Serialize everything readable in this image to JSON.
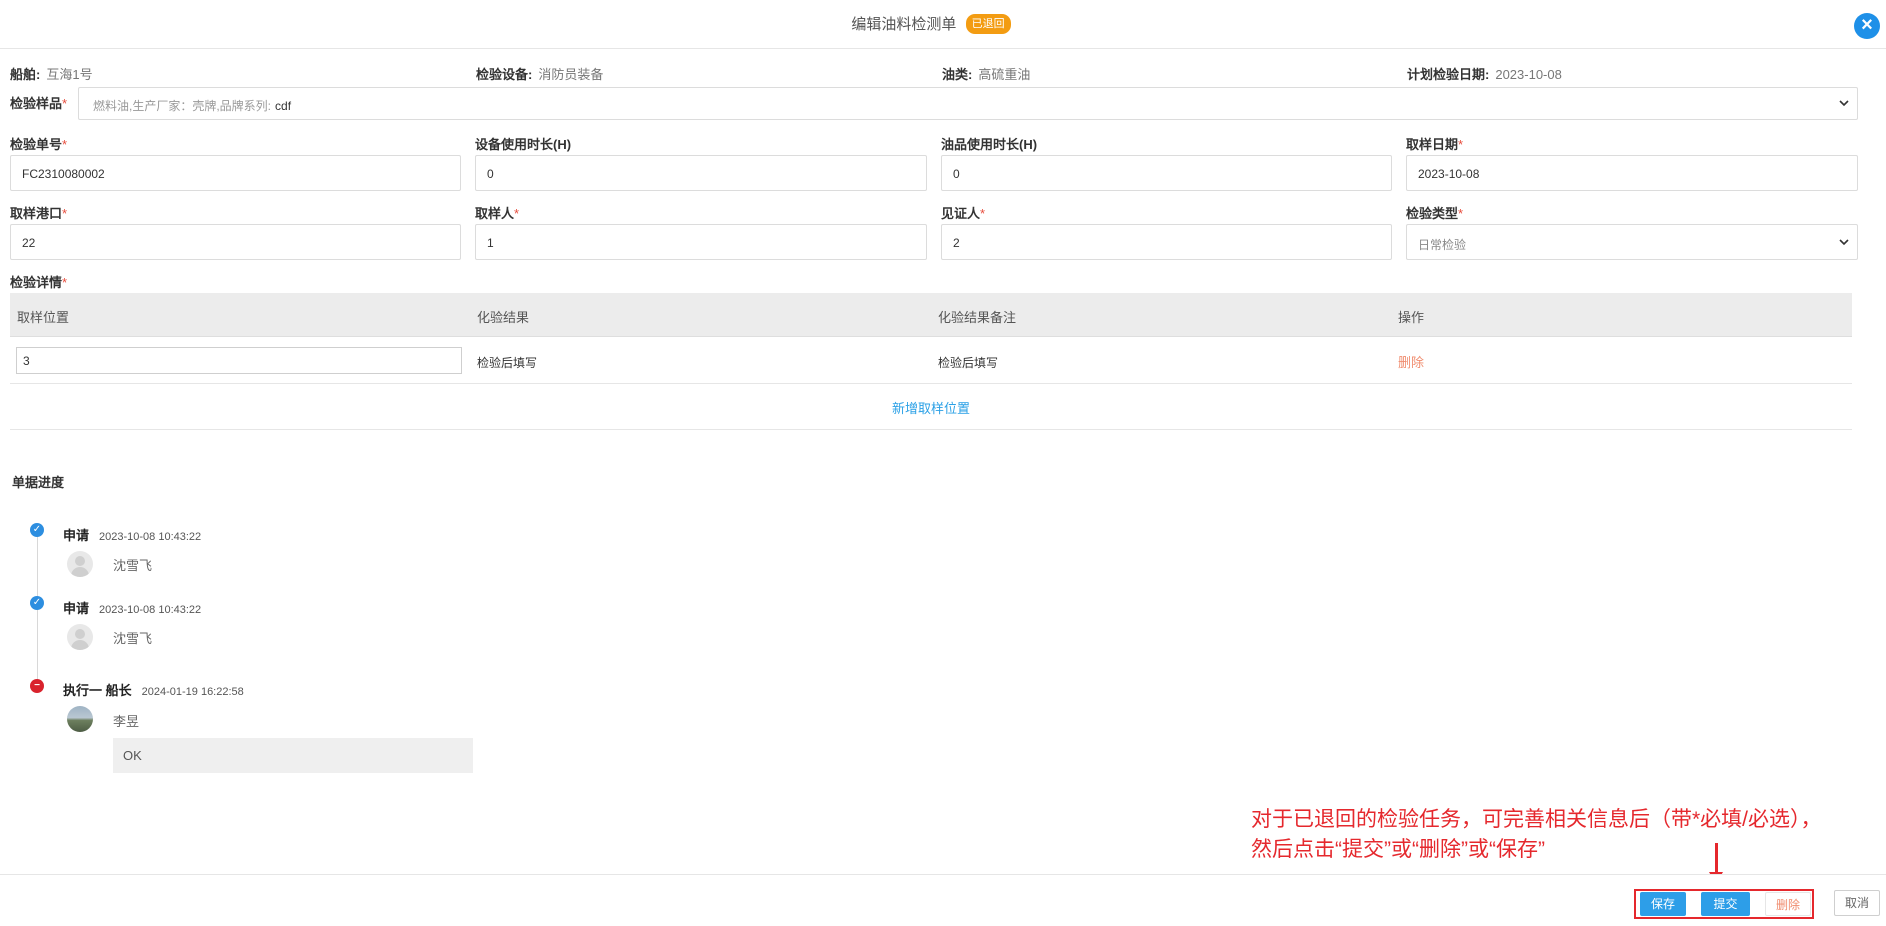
{
  "header": {
    "title": "编辑油料检测单",
    "status_badge": "已退回",
    "close_icon": "close-icon"
  },
  "info": [
    {
      "label": "船舶:",
      "value": "互海1号"
    },
    {
      "label": "检验设备:",
      "value": "消防员装备"
    },
    {
      "label": "油类:",
      "value": "高硫重油"
    },
    {
      "label": "计划检验日期:",
      "value": "2023-10-08"
    }
  ],
  "sample": {
    "label": "检验样品",
    "required": "*",
    "placeholder": "燃料油,生产厂家：壳牌,品牌系列:",
    "value": "cdf"
  },
  "fields": {
    "order_no": {
      "label": "检验单号",
      "required": "*",
      "value": "FC2310080002"
    },
    "equip_hours": {
      "label": "设备使用时长(H)",
      "value": "0"
    },
    "oil_hours": {
      "label": "油品使用时长(H)",
      "value": "0"
    },
    "sample_date": {
      "label": "取样日期",
      "required": "*",
      "value": "2023-10-08"
    },
    "sample_port": {
      "label": "取样港口",
      "required": "*",
      "value": "22"
    },
    "sampler": {
      "label": "取样人",
      "required": "*",
      "value": "1"
    },
    "witness": {
      "label": "见证人",
      "required": "*",
      "value": "2"
    },
    "inspect_type": {
      "label": "检验类型",
      "required": "*",
      "value": "日常检验"
    }
  },
  "details": {
    "label": "检验详情",
    "required": "*",
    "columns": [
      "取样位置",
      "化验结果",
      "化验结果备注",
      "操作"
    ],
    "rows": [
      {
        "position": "3",
        "result": "检验后填写",
        "remark": "检验后填写",
        "action": "删除"
      }
    ],
    "add_label": "新增取样位置"
  },
  "progress": {
    "title": "单据进度",
    "steps": [
      {
        "title": "申请",
        "time": "2023-10-08 10:43:22",
        "user": "沈雪飞",
        "status": "done"
      },
      {
        "title": "申请",
        "time": "2023-10-08 10:43:22",
        "user": "沈雪飞",
        "status": "done"
      },
      {
        "title": "执行一 船长",
        "time": "2024-01-19 16:22:58",
        "user": "李昱",
        "status": "rejected",
        "comment": "OK"
      }
    ]
  },
  "annotation": {
    "line1": "对于已退回的检验任务，可完善相关信息后（带*必填/必选），",
    "line2": "然后点击“提交”或“删除”或“保存”"
  },
  "footer": {
    "save": "保存",
    "submit": "提交",
    "delete": "删除",
    "cancel": "取消"
  },
  "colors": {
    "primary": "#2d9ee8",
    "danger": "#d9232d",
    "badge": "#f39c12",
    "annotation": "#e5282d"
  }
}
